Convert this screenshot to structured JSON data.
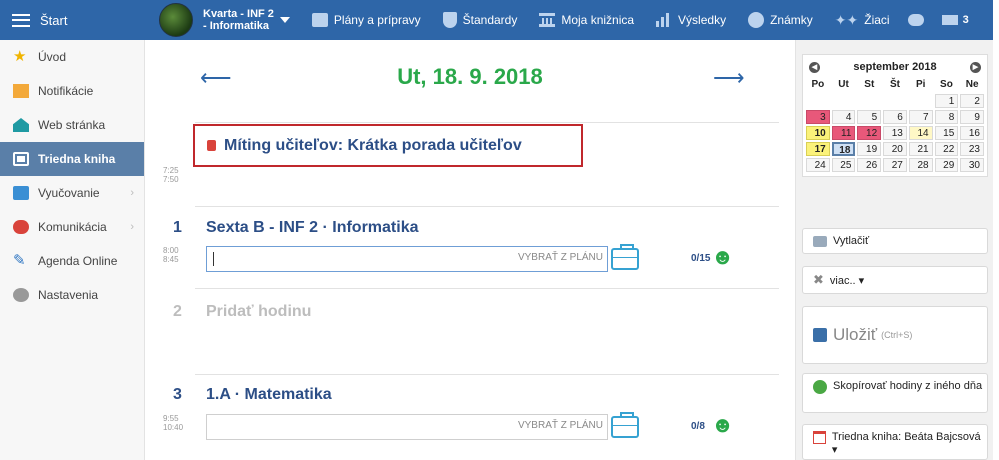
{
  "topbar": {
    "start_label": "Štart",
    "class_line1": "Kvarta - INF 2",
    "class_line2": "- Informatika",
    "nav": [
      {
        "label": "Plány a prípravy",
        "icon": "briefcase-icon"
      },
      {
        "label": "Štandardy",
        "icon": "shield-icon"
      },
      {
        "label": "Moja knižnica",
        "icon": "library-icon"
      },
      {
        "label": "Výsledky",
        "icon": "bar-chart-icon"
      },
      {
        "label": "Známky",
        "icon": "grade-icon"
      },
      {
        "label": "Žiaci",
        "icon": "students-icon"
      }
    ],
    "mail_count": "3"
  },
  "sidebar": {
    "items": [
      {
        "label": "Úvod"
      },
      {
        "label": "Notifikácie"
      },
      {
        "label": "Web stránka"
      },
      {
        "label": "Triedna kniha"
      },
      {
        "label": "Vyučovanie"
      },
      {
        "label": "Komunikácia"
      },
      {
        "label": "Agenda Online"
      },
      {
        "label": "Nastavenia"
      }
    ]
  },
  "main": {
    "date_title": "Ut, 18. 9. 2018",
    "meeting": {
      "time_start": "7:25",
      "time_end": "7:50",
      "title": "Míting učiteľov: Krátka porada učiteľov"
    },
    "lessons": [
      {
        "num": "1",
        "title": "Sexta B - INF 2 · Informatika",
        "time_start": "8:00",
        "time_end": "8:45",
        "placeholder": "VYBRAŤ Z PLÁNU",
        "count": "0/15"
      },
      {
        "num": "2",
        "title": "Pridať hodinu"
      },
      {
        "num": "3",
        "title": "1.A · Matematika",
        "time_start": "9:55",
        "time_end": "10:40",
        "placeholder": "VYBRAŤ Z PLÁNU",
        "count": "0/8"
      }
    ]
  },
  "calendar": {
    "month_label": "september 2018",
    "weekdays": [
      "Po",
      "Ut",
      "St",
      "Št",
      "Pi",
      "So",
      "Ne"
    ],
    "weeks": [
      [
        "",
        "",
        "",
        "",
        "",
        "1",
        "2"
      ],
      [
        "3",
        "4",
        "5",
        "6",
        "7",
        "8",
        "9"
      ],
      [
        "10",
        "11",
        "12",
        "13",
        "14",
        "15",
        "16"
      ],
      [
        "17",
        "18",
        "19",
        "20",
        "21",
        "22",
        "23"
      ],
      [
        "24",
        "25",
        "26",
        "27",
        "28",
        "29",
        "30"
      ]
    ]
  },
  "actions": {
    "print_label": "Vytlačiť",
    "more_label": "viac.. ▾",
    "save_label": "Uložiť",
    "save_shortcut": "(Ctrl+S)",
    "copy_label": "Skopírovať hodiny z iného dňa",
    "book_label": "Triedna kniha: Beáta Bajcsová ▾"
  }
}
